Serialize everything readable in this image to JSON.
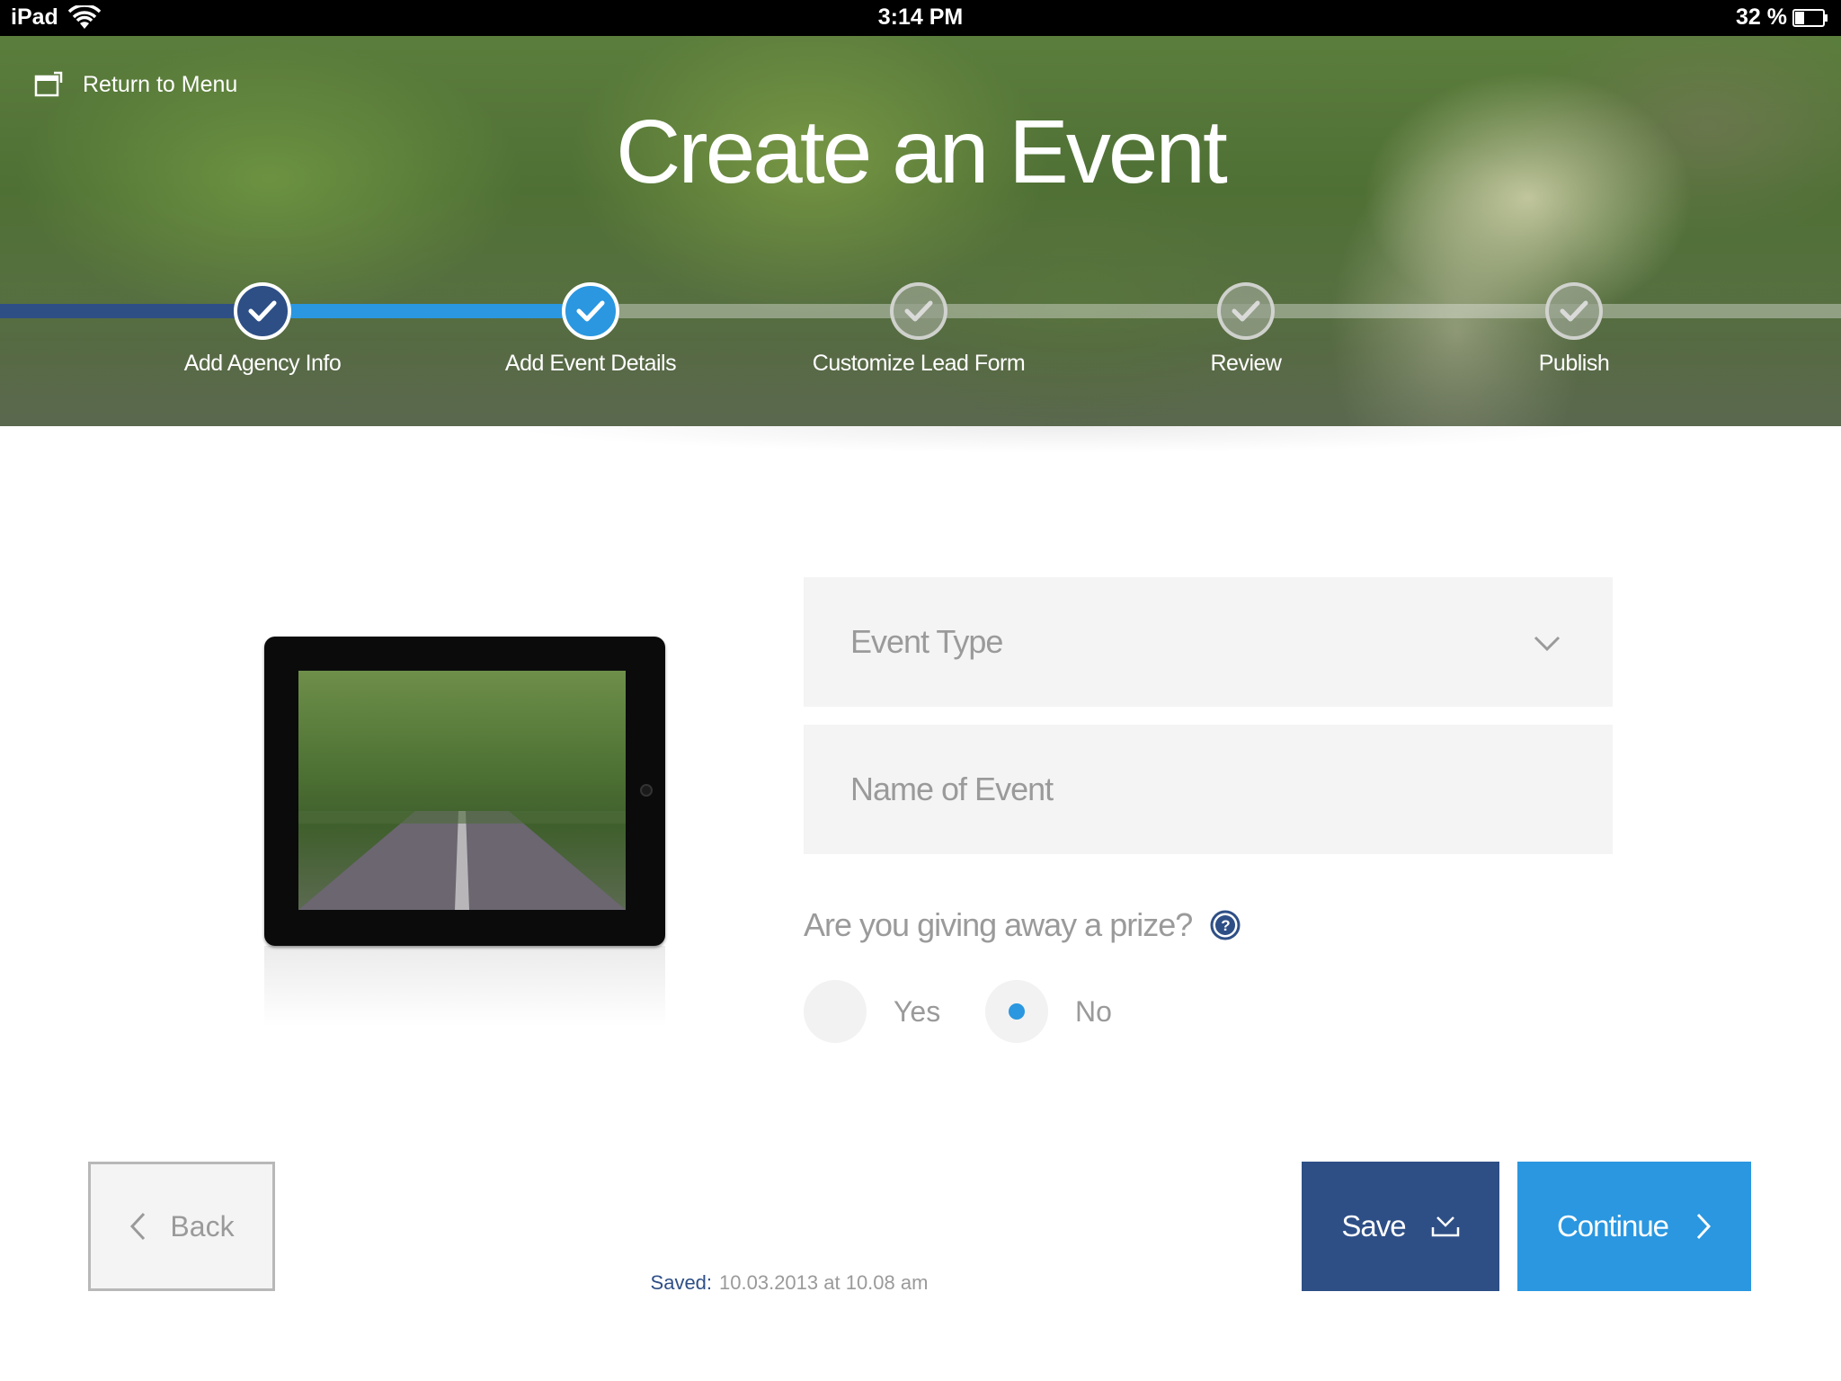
{
  "status_bar": {
    "device": "iPad",
    "time": "3:14 PM",
    "battery": "32 %"
  },
  "header": {
    "return_label": "Return to Menu",
    "title": "Create an Event"
  },
  "steps": [
    {
      "label": "Add Agency Info",
      "state": "done"
    },
    {
      "label": "Add Event Details",
      "state": "active"
    },
    {
      "label": "Customize Lead Form",
      "state": "todo"
    },
    {
      "label": "Review",
      "state": "todo"
    },
    {
      "label": "Publish",
      "state": "todo"
    }
  ],
  "form": {
    "event_type_placeholder": "Event Type",
    "event_name_placeholder": "Name of Event",
    "prize_question": "Are you giving away a prize?",
    "options": [
      {
        "label": "Yes",
        "selected": false
      },
      {
        "label": "No",
        "selected": true
      }
    ]
  },
  "footer": {
    "back_label": "Back",
    "saved_key": "Saved:",
    "saved_value": "10.03.2013 at 10.08 am",
    "save_label": "Save",
    "continue_label": "Continue"
  },
  "colors": {
    "done": "#2e4f86",
    "active": "#2a97e0",
    "field_bg": "#f4f4f4",
    "muted_text": "#9a9a9a"
  },
  "icons": [
    "wifi-icon",
    "battery-icon",
    "window-icon",
    "check-icon",
    "chevron-down-icon",
    "help-icon",
    "chevron-left-icon",
    "download-icon",
    "chevron-right-icon"
  ]
}
